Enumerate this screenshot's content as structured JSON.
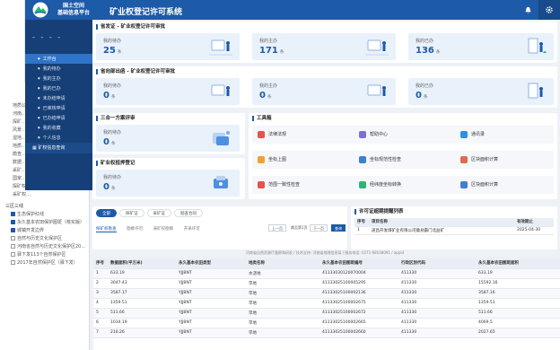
{
  "header": {
    "brand_line1": "国土空间",
    "brand_line2": "基础信息平台",
    "system_name": "矿业权登记许可系统",
    "bell_icon": "bell-icon",
    "gear_icon": "gear-icon"
  },
  "sidenav": {
    "user": "- - - -",
    "items": [
      "工作台",
      "我的待办",
      "我的主办",
      "我的已办",
      "未办结申请",
      "已审核申请",
      "已办结申请",
      "我的收藏",
      "个人信息"
    ],
    "group": "矿权信息查询"
  },
  "layers": {
    "rows": [
      "地质公…",
      "河南…",
      "探矿…",
      "风景…",
      "湿地…",
      "地质…",
      "勘查…",
      "数据…",
      "采矿…",
      "国家…",
      "探矿权…",
      "采矿权…"
    ],
    "group": "三区三线",
    "checks": [
      {
        "label": "生态保护红线",
        "on": true
      },
      {
        "label": "永久基本农田保护图斑（核实版）",
        "on": true
      },
      {
        "label": "城镇开发边界",
        "on": true
      },
      {
        "label": "自然与历史文化保护区",
        "on": false
      },
      {
        "label": "河南省自然与历史文化保护区20…",
        "on": false
      },
      {
        "label": "驿下发113个自然保护区",
        "on": false
      },
      {
        "label": "2017年自然保护区（驿下发）",
        "on": false
      }
    ]
  },
  "sections": {
    "province": {
      "title": "省发证 - 矿业权登记许可审批",
      "cards": [
        {
          "label": "我的待办",
          "value": "25",
          "unit": "条"
        },
        {
          "label": "我的主办",
          "value": "171",
          "unit": "条"
        },
        {
          "label": "我的已办",
          "value": "136",
          "unit": "条"
        }
      ]
    },
    "ministry": {
      "title": "省向部出函 - 矿业权登记许可审批",
      "cards": [
        {
          "label": "我的待办",
          "value": "0",
          "unit": "条"
        },
        {
          "label": "我的主办",
          "value": "0",
          "unit": "条"
        },
        {
          "label": "我的已办",
          "value": "0",
          "unit": "条"
        }
      ]
    },
    "three": {
      "title": "三合一方案评审",
      "label": "我的待办",
      "value": "0",
      "unit": "条"
    },
    "mortgage": {
      "title": "矿业权抵押登记",
      "label": "我的待办",
      "value": "0",
      "unit": "条"
    }
  },
  "toolbox": {
    "title": "工具箱",
    "tools": [
      {
        "label": "法律法规",
        "color": "#e5534b"
      },
      {
        "label": "帮助中心",
        "color": "#7b6fd6"
      },
      {
        "label": "通讯录",
        "color": "#2f8fe0"
      },
      {
        "label": "坐标上图",
        "color": "#f0a030"
      },
      {
        "label": "坐标规范性检查",
        "color": "#3b7fd6"
      },
      {
        "label": "区块面积计算",
        "color": "#e06a4b"
      },
      {
        "label": "范围一致性检查",
        "color": "#e5534b"
      },
      {
        "label": "经纬度坐标转换",
        "color": "#2bb673"
      },
      {
        "label": "区块面积计算",
        "color": "#3b7fd6"
      }
    ]
  },
  "query": {
    "tabs": [
      "全部",
      "探矿证",
      "采矿证",
      "勘查合同"
    ],
    "subtabs": [
      "探矿权勘查",
      "勘察许可",
      "采矿权勘察",
      "开采许可"
    ],
    "pager": [
      "上一页",
      "跳至第1页",
      "下一页",
      "共1页"
    ],
    "pager_search": "查询"
  },
  "expire": {
    "title": "许可证超期提醒列表",
    "headers": [
      "序号",
      "项目名称",
      "有效期止"
    ],
    "rows": [
      [
        "1",
        "遂昌开发煤矿业有限公司徽县霸门北益矿",
        "2025-04-30"
      ]
    ]
  },
  "footer": "河南省自然资源厅督察和研发 / 技术支持: 河南省地理信息局 / 服务电话: 0371-68108091 / appid",
  "table": {
    "headers": [
      "序号",
      "数据面积(平方米)",
      "永久基本农田类型",
      "地类名称",
      "永久基本农田图斑编号",
      "行政区划代码",
      "永久基本农田图斑面积"
    ],
    "rows": [
      [
        "1",
        "633.19",
        "YJJBNT",
        "水浇地",
        "41133030120070004",
        "411330",
        "633.19"
      ],
      [
        "2",
        "3047.43",
        "YJJBNT",
        "旱地",
        "41133025100005295",
        "411330",
        "15592.16"
      ],
      [
        "3",
        "3587.17",
        "YJJBNT",
        "旱地",
        "41133025100002136",
        "411330",
        "3587.16"
      ],
      [
        "4",
        "1359.51",
        "YJJBNT",
        "旱地",
        "41133025100002675",
        "411330",
        "1359.51"
      ],
      [
        "5",
        "511.66",
        "YJJBNT",
        "旱地",
        "41133025100002672",
        "411330",
        "511.66"
      ],
      [
        "6",
        "1034.19",
        "YJJBNT",
        "旱地",
        "41133025100002665",
        "411330",
        "4069.5"
      ],
      [
        "7",
        "216.26",
        "YJJBNT",
        "旱地",
        "41133025100002660",
        "411330",
        "2027.65"
      ]
    ]
  }
}
